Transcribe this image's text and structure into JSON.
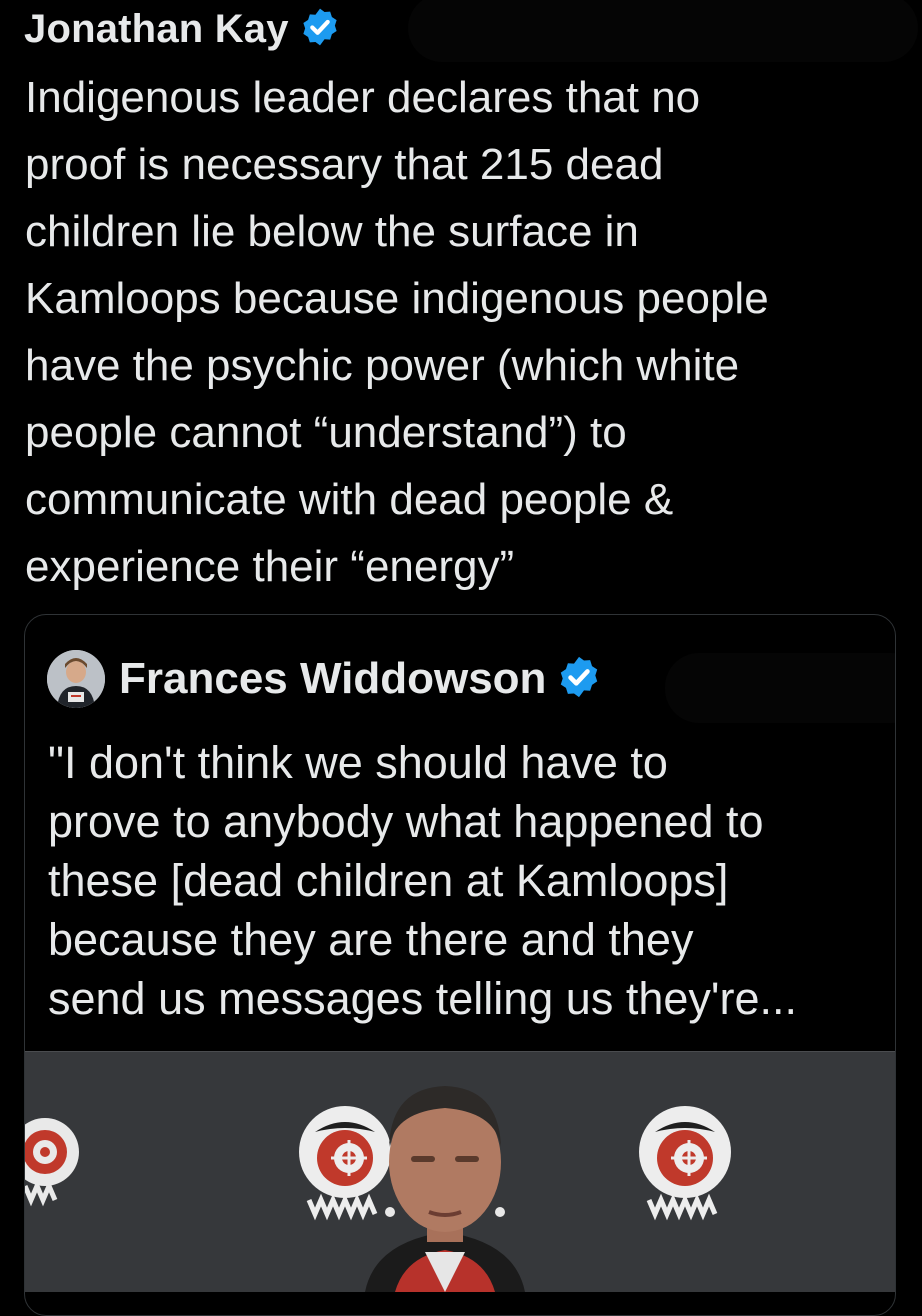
{
  "tweet": {
    "author_name": "Jonathan Kay",
    "verified_icon": "verified-badge-icon",
    "text": "Indigenous leader declares that no\nproof is necessary that 215 dead\nchildren lie below the surface in\nKamloops because indigenous people\nhave the psychic power (which white\npeople cannot “understand”) to\ncommunicate with dead people &\nexperience their “energy”"
  },
  "quote": {
    "author_name": "Frances Widdowson",
    "verified_icon": "verified-badge-icon",
    "text": "\"I don't think we should have to\nprove to anybody what happened to\nthese [dead children at Kamloops]\nbecause they are there and they\nsend us messages telling us they're...",
    "media_icon": "video-thumbnail"
  },
  "colors": {
    "background": "#000000",
    "text": "#e7e9ea",
    "verified": "#1d9bf0",
    "card_border": "#2f3336"
  }
}
